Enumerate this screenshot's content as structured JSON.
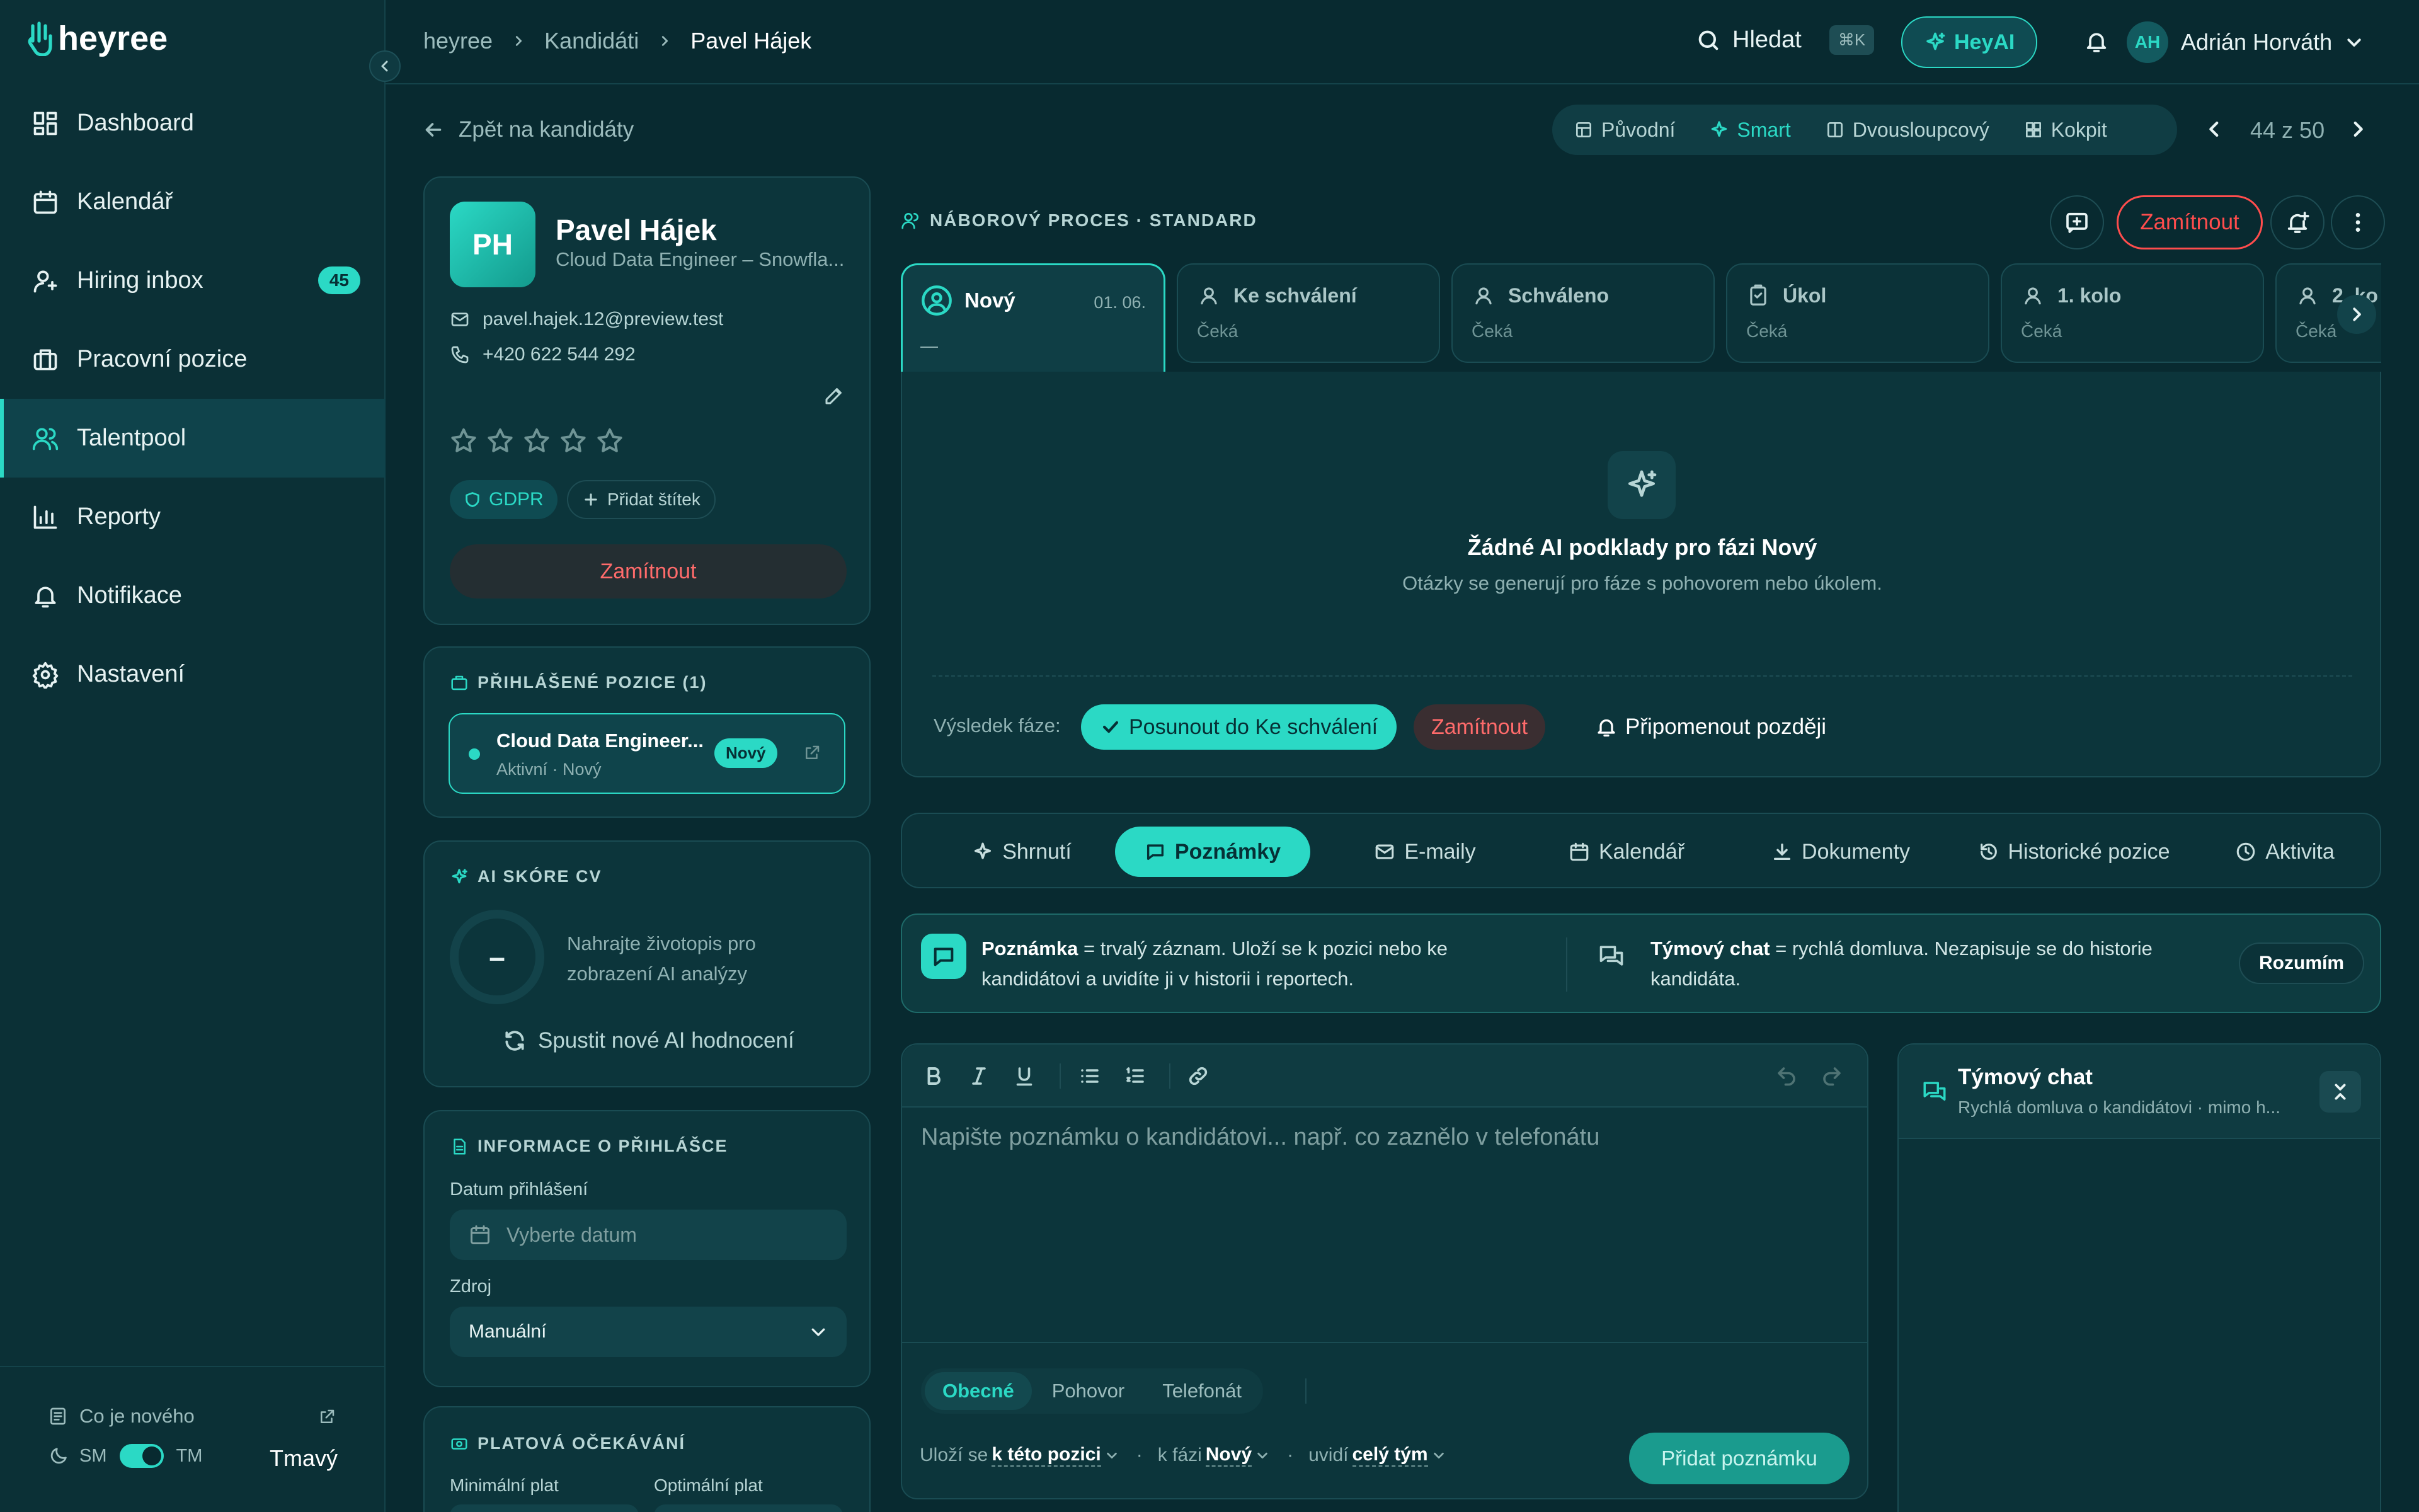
{
  "app": {
    "name": "heyree"
  },
  "sidebar": {
    "items": [
      {
        "label": "Dashboard",
        "icon": "dashboard-icon"
      },
      {
        "label": "Kalendář",
        "icon": "calendar-icon"
      },
      {
        "label": "Hiring inbox",
        "icon": "inbox-user-icon",
        "badge": "45"
      },
      {
        "label": "Pracovní pozice",
        "icon": "briefcase-icon"
      },
      {
        "label": "Talentpool",
        "icon": "users-icon",
        "active": true
      },
      {
        "label": "Reporty",
        "icon": "chart-icon"
      },
      {
        "label": "Notifikace",
        "icon": "bell-icon"
      },
      {
        "label": "Nastavení",
        "icon": "gear-icon"
      }
    ],
    "whats_new": "Co je nového",
    "theme": {
      "left": "SM",
      "right": "TM",
      "current": "Tmavý"
    }
  },
  "topbar": {
    "breadcrumb": [
      "heyree",
      "Kandidáti",
      "Pavel Hájek"
    ],
    "search_label": "Hledat",
    "search_kbd": "⌘K",
    "heyai_label": "HeyAI",
    "user": {
      "initials": "AH",
      "name": "Adrián Horváth"
    }
  },
  "toolbar": {
    "back": "Zpět na kandidáty",
    "views": [
      "Původní",
      "Smart",
      "Dvousloupcový",
      "Kokpit"
    ],
    "active_view": "Smart",
    "pager": "44 z 50"
  },
  "candidate": {
    "initials": "PH",
    "name": "Pavel Hájek",
    "role": "Cloud Data Engineer – Snowfla...",
    "email": "pavel.hajek.12@preview.test",
    "phone": "+420 622 544 292",
    "rating": 0,
    "tags": {
      "gdpr": "GDPR",
      "add_tag": "Přidat štítek"
    },
    "reject": "Zamítnout"
  },
  "positions": {
    "title": "PŘIHLÁŠENÉ POZICE (1)",
    "items": [
      {
        "name": "Cloud Data Engineer...",
        "status": "Aktivní · Nový",
        "badge": "Nový"
      }
    ]
  },
  "ai_score": {
    "title": "AI SKÓRE CV",
    "value": "–",
    "hint_line1": "Nahrajte životopis pro",
    "hint_line2": "zobrazení AI analýzy",
    "action": "Spustit nové AI hodnocení"
  },
  "application_info": {
    "title": "INFORMACE O PŘIHLÁŠCE",
    "date_label": "Datum přihlášení",
    "date_placeholder": "Vyberte datum",
    "source_label": "Zdroj",
    "source_value": "Manuální"
  },
  "salary": {
    "title": "PLATOVÁ OČEKÁVÁNÍ",
    "min_label": "Minimální plat",
    "opt_label": "Optimální plat"
  },
  "process": {
    "title": "NÁBOROVÝ PROCES · STANDARD",
    "reject": "Zamítnout",
    "stages": [
      {
        "name": "Nový",
        "date": "01. 06.",
        "sub": "—",
        "active": true
      },
      {
        "name": "Ke schválení",
        "sub": "Čeká"
      },
      {
        "name": "Schváleno",
        "sub": "Čeká"
      },
      {
        "name": "Úkol",
        "sub": "Čeká"
      },
      {
        "name": "1. kolo",
        "sub": "Čeká"
      },
      {
        "name": "2. ko",
        "sub": "Čeká"
      }
    ],
    "empty_title": "Žádné AI podklady pro fázi Nový",
    "empty_sub": "Otázky se generují pro fáze s pohovorem nebo úkolem.",
    "result_label": "Výsledek fáze:",
    "advance": "Posunout do Ke schválení",
    "reject_small": "Zamítnout",
    "remind": "Připomenout později"
  },
  "tabs": [
    "Shrnutí",
    "Poznámky",
    "E-maily",
    "Kalendář",
    "Dokumenty",
    "Historické pozice",
    "Aktivita"
  ],
  "active_tab": "Poznámky",
  "info_banner": {
    "note_bold": "Poznámka",
    "note_text": " = trvalý záznam. Uloží se k pozici nebo ke",
    "note_text2": "kandidátovi a uvidíte ji v historii i reportech.",
    "chat_bold": "Týmový chat",
    "chat_text": " = rychlá domluva. Nezapisuje se do historie",
    "chat_text2": "kandidáta.",
    "ok": "Rozumím"
  },
  "editor": {
    "placeholder": "Napište poznámku o kandidátovi... např. co zaznělo v telefonátu",
    "types": [
      "Obecné",
      "Pohovor",
      "Telefonát"
    ],
    "active_type": "Obecné",
    "save_to_label": "Uloží se",
    "save_to": "k této pozici",
    "phase_label": "k fázi",
    "phase": "Nový",
    "visible_label": "uvidí",
    "visible": "celý tým",
    "submit": "Přidat poznámku"
  },
  "team_chat": {
    "title": "Týmový chat",
    "subtitle": "Rychlá domluva o kandidátovi · mimo h..."
  },
  "colors": {
    "accent": "#2bd9c5",
    "bg": "#082a30",
    "danger": "#ff5c5c"
  }
}
